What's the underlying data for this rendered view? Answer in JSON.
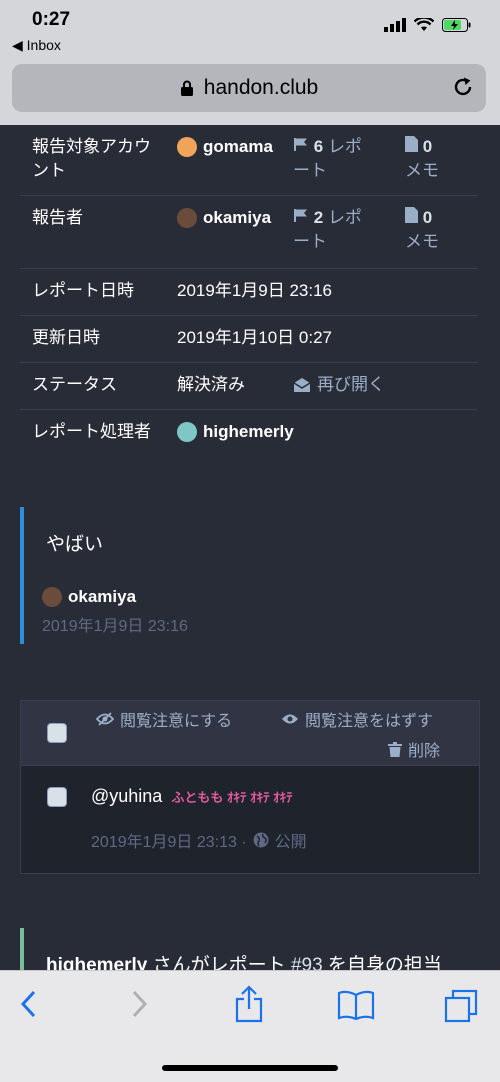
{
  "status": {
    "time": "0:27",
    "back_label": "◀ Inbox"
  },
  "browser": {
    "url": "handon.club"
  },
  "report": {
    "rows": [
      {
        "label": "報告対象アカウント",
        "value": "gomama",
        "reports_count": "6",
        "reports_unit": "レポート",
        "notes_count": "0",
        "notes_unit": "メモ"
      },
      {
        "label": "報告者",
        "value": "okamiya",
        "reports_count": "2",
        "reports_unit": "レポート",
        "notes_count": "0",
        "notes_unit": "メモ"
      },
      {
        "label": "レポート日時",
        "value": "2019年1月9日 23:16"
      },
      {
        "label": "更新日時",
        "value": "2019年1月10日 0:27"
      },
      {
        "label": "ステータス",
        "value": "解決済み",
        "action": "再び開く"
      },
      {
        "label": "レポート処理者",
        "value": "highemerly"
      }
    ]
  },
  "comment": {
    "text": "やばい",
    "author": "okamiya",
    "time": "2019年1月9日 23:16"
  },
  "batch": {
    "mark_sensitive": "閲覧注意にする",
    "unmark_sensitive": "閲覧注意をはずす",
    "delete": "削除",
    "status_text": "@yuhina",
    "status_emoji": "ふともも ｵｷﾃ ｵｷﾃ ｵｷﾃ",
    "status_time": "2019年1月9日 23:13 ·",
    "status_visibility": "公開"
  },
  "log": {
    "actor": "highemerly",
    "middle": " さんがレポート ",
    "report_id": "#93",
    "tail": " を自身の担当"
  },
  "colors": {
    "background": "#282c37",
    "accent_blue": "#2b90d9",
    "accent_green": "#79bd9a",
    "toolbar_blue": "#1a73e8"
  }
}
